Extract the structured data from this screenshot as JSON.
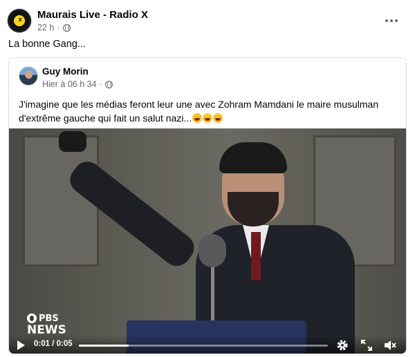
{
  "post": {
    "page_name": "Maurais Live - Radio X",
    "time": "22 h",
    "audience_icon": "globe-icon",
    "caption": "La bonne Gang...",
    "avatar_logo_text": "CHOI 98.1 RADIO X"
  },
  "shared_post": {
    "author": "Guy Morin",
    "time": "Hier à 06 h 34",
    "audience_icon": "globe-icon",
    "text": "J'imagine que les médias feront leur une avec Zohram Mamdani le maire musulman d'extrême gauche qui fait un salut nazi...",
    "emoji_count": 3,
    "emoji_icon": "laughing-tears-emoji"
  },
  "video": {
    "watermark_top": "PBS",
    "watermark_bottom": "NEWS",
    "time_display": "0:01 / 0:05",
    "progress": 0.2,
    "icons": {
      "play": "play-icon",
      "settings": "gear-icon",
      "fullscreen": "fullscreen-icon",
      "mute": "muted-speaker-icon"
    }
  },
  "colors": {
    "secondary_text": "#65676b",
    "card_border": "#dadde1",
    "podium": "#27355e"
  }
}
